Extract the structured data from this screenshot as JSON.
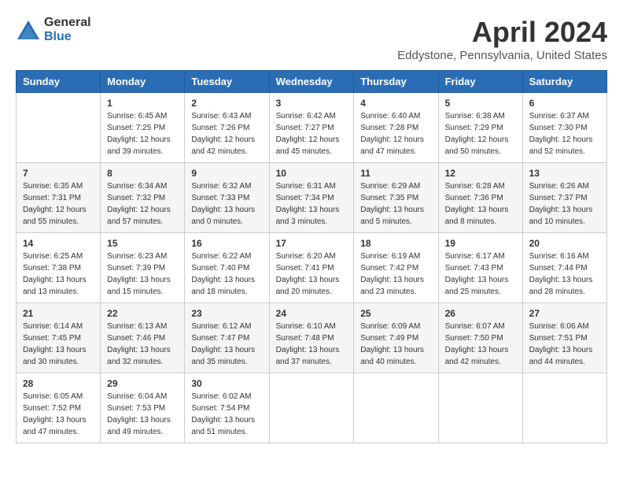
{
  "logo": {
    "general": "General",
    "blue": "Blue"
  },
  "title": "April 2024",
  "subtitle": "Eddystone, Pennsylvania, United States",
  "days_of_week": [
    "Sunday",
    "Monday",
    "Tuesday",
    "Wednesday",
    "Thursday",
    "Friday",
    "Saturday"
  ],
  "weeks": [
    [
      {
        "day": "",
        "sunrise": "",
        "sunset": "",
        "daylight": ""
      },
      {
        "day": "1",
        "sunrise": "Sunrise: 6:45 AM",
        "sunset": "Sunset: 7:25 PM",
        "daylight": "Daylight: 12 hours and 39 minutes."
      },
      {
        "day": "2",
        "sunrise": "Sunrise: 6:43 AM",
        "sunset": "Sunset: 7:26 PM",
        "daylight": "Daylight: 12 hours and 42 minutes."
      },
      {
        "day": "3",
        "sunrise": "Sunrise: 6:42 AM",
        "sunset": "Sunset: 7:27 PM",
        "daylight": "Daylight: 12 hours and 45 minutes."
      },
      {
        "day": "4",
        "sunrise": "Sunrise: 6:40 AM",
        "sunset": "Sunset: 7:28 PM",
        "daylight": "Daylight: 12 hours and 47 minutes."
      },
      {
        "day": "5",
        "sunrise": "Sunrise: 6:38 AM",
        "sunset": "Sunset: 7:29 PM",
        "daylight": "Daylight: 12 hours and 50 minutes."
      },
      {
        "day": "6",
        "sunrise": "Sunrise: 6:37 AM",
        "sunset": "Sunset: 7:30 PM",
        "daylight": "Daylight: 12 hours and 52 minutes."
      }
    ],
    [
      {
        "day": "7",
        "sunrise": "Sunrise: 6:35 AM",
        "sunset": "Sunset: 7:31 PM",
        "daylight": "Daylight: 12 hours and 55 minutes."
      },
      {
        "day": "8",
        "sunrise": "Sunrise: 6:34 AM",
        "sunset": "Sunset: 7:32 PM",
        "daylight": "Daylight: 12 hours and 57 minutes."
      },
      {
        "day": "9",
        "sunrise": "Sunrise: 6:32 AM",
        "sunset": "Sunset: 7:33 PM",
        "daylight": "Daylight: 13 hours and 0 minutes."
      },
      {
        "day": "10",
        "sunrise": "Sunrise: 6:31 AM",
        "sunset": "Sunset: 7:34 PM",
        "daylight": "Daylight: 13 hours and 3 minutes."
      },
      {
        "day": "11",
        "sunrise": "Sunrise: 6:29 AM",
        "sunset": "Sunset: 7:35 PM",
        "daylight": "Daylight: 13 hours and 5 minutes."
      },
      {
        "day": "12",
        "sunrise": "Sunrise: 6:28 AM",
        "sunset": "Sunset: 7:36 PM",
        "daylight": "Daylight: 13 hours and 8 minutes."
      },
      {
        "day": "13",
        "sunrise": "Sunrise: 6:26 AM",
        "sunset": "Sunset: 7:37 PM",
        "daylight": "Daylight: 13 hours and 10 minutes."
      }
    ],
    [
      {
        "day": "14",
        "sunrise": "Sunrise: 6:25 AM",
        "sunset": "Sunset: 7:38 PM",
        "daylight": "Daylight: 13 hours and 13 minutes."
      },
      {
        "day": "15",
        "sunrise": "Sunrise: 6:23 AM",
        "sunset": "Sunset: 7:39 PM",
        "daylight": "Daylight: 13 hours and 15 minutes."
      },
      {
        "day": "16",
        "sunrise": "Sunrise: 6:22 AM",
        "sunset": "Sunset: 7:40 PM",
        "daylight": "Daylight: 13 hours and 18 minutes."
      },
      {
        "day": "17",
        "sunrise": "Sunrise: 6:20 AM",
        "sunset": "Sunset: 7:41 PM",
        "daylight": "Daylight: 13 hours and 20 minutes."
      },
      {
        "day": "18",
        "sunrise": "Sunrise: 6:19 AM",
        "sunset": "Sunset: 7:42 PM",
        "daylight": "Daylight: 13 hours and 23 minutes."
      },
      {
        "day": "19",
        "sunrise": "Sunrise: 6:17 AM",
        "sunset": "Sunset: 7:43 PM",
        "daylight": "Daylight: 13 hours and 25 minutes."
      },
      {
        "day": "20",
        "sunrise": "Sunrise: 6:16 AM",
        "sunset": "Sunset: 7:44 PM",
        "daylight": "Daylight: 13 hours and 28 minutes."
      }
    ],
    [
      {
        "day": "21",
        "sunrise": "Sunrise: 6:14 AM",
        "sunset": "Sunset: 7:45 PM",
        "daylight": "Daylight: 13 hours and 30 minutes."
      },
      {
        "day": "22",
        "sunrise": "Sunrise: 6:13 AM",
        "sunset": "Sunset: 7:46 PM",
        "daylight": "Daylight: 13 hours and 32 minutes."
      },
      {
        "day": "23",
        "sunrise": "Sunrise: 6:12 AM",
        "sunset": "Sunset: 7:47 PM",
        "daylight": "Daylight: 13 hours and 35 minutes."
      },
      {
        "day": "24",
        "sunrise": "Sunrise: 6:10 AM",
        "sunset": "Sunset: 7:48 PM",
        "daylight": "Daylight: 13 hours and 37 minutes."
      },
      {
        "day": "25",
        "sunrise": "Sunrise: 6:09 AM",
        "sunset": "Sunset: 7:49 PM",
        "daylight": "Daylight: 13 hours and 40 minutes."
      },
      {
        "day": "26",
        "sunrise": "Sunrise: 6:07 AM",
        "sunset": "Sunset: 7:50 PM",
        "daylight": "Daylight: 13 hours and 42 minutes."
      },
      {
        "day": "27",
        "sunrise": "Sunrise: 6:06 AM",
        "sunset": "Sunset: 7:51 PM",
        "daylight": "Daylight: 13 hours and 44 minutes."
      }
    ],
    [
      {
        "day": "28",
        "sunrise": "Sunrise: 6:05 AM",
        "sunset": "Sunset: 7:52 PM",
        "daylight": "Daylight: 13 hours and 47 minutes."
      },
      {
        "day": "29",
        "sunrise": "Sunrise: 6:04 AM",
        "sunset": "Sunset: 7:53 PM",
        "daylight": "Daylight: 13 hours and 49 minutes."
      },
      {
        "day": "30",
        "sunrise": "Sunrise: 6:02 AM",
        "sunset": "Sunset: 7:54 PM",
        "daylight": "Daylight: 13 hours and 51 minutes."
      },
      {
        "day": "",
        "sunrise": "",
        "sunset": "",
        "daylight": ""
      },
      {
        "day": "",
        "sunrise": "",
        "sunset": "",
        "daylight": ""
      },
      {
        "day": "",
        "sunrise": "",
        "sunset": "",
        "daylight": ""
      },
      {
        "day": "",
        "sunrise": "",
        "sunset": "",
        "daylight": ""
      }
    ]
  ]
}
